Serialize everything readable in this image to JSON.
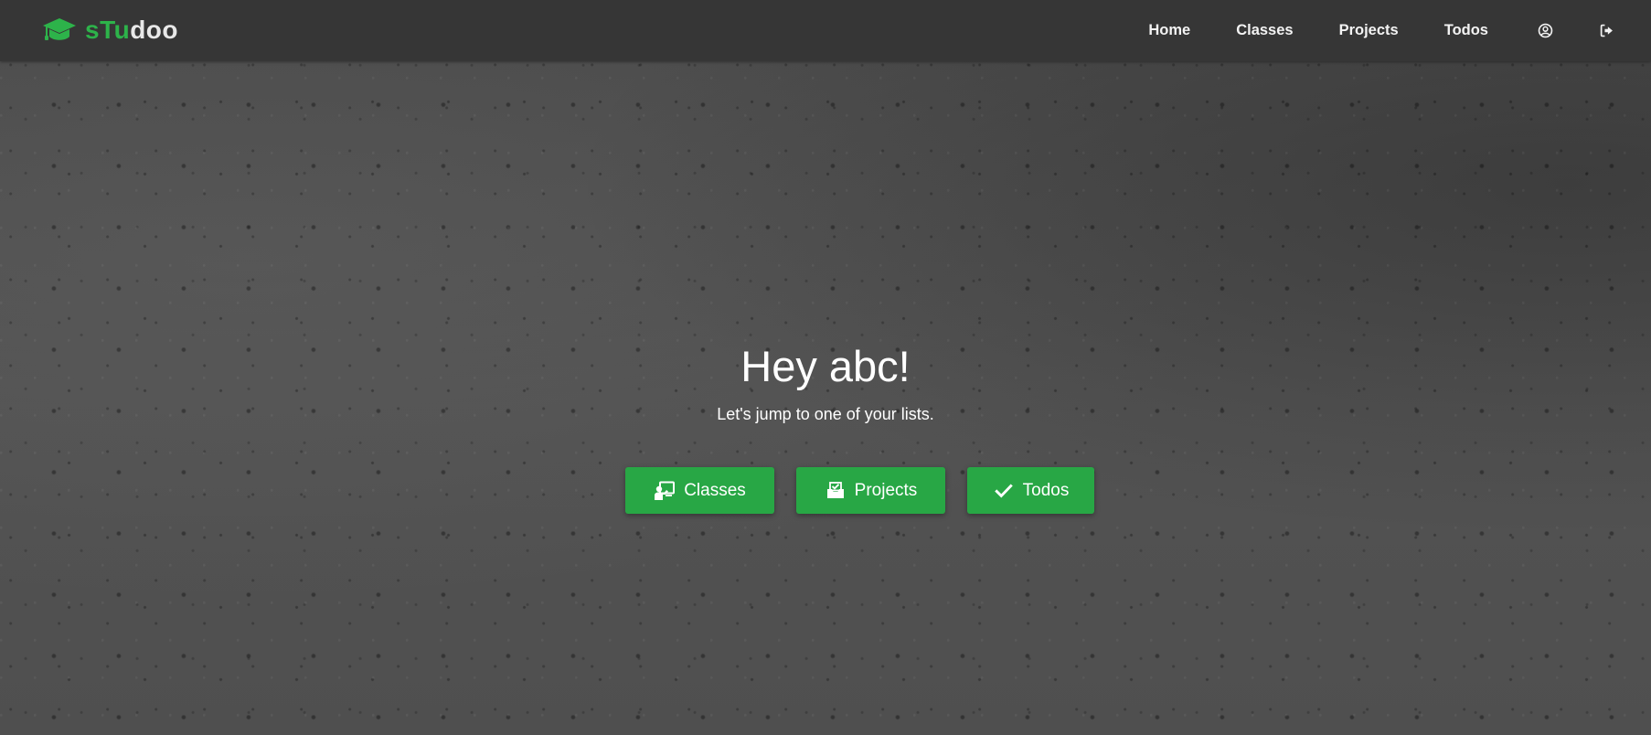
{
  "brand": {
    "part1": "sTu",
    "part2": "doo",
    "icon": "graduation-cap-icon",
    "accent_color": "#2db34a"
  },
  "nav": {
    "items": [
      {
        "label": "Home"
      },
      {
        "label": "Classes"
      },
      {
        "label": "Projects"
      },
      {
        "label": "Todos"
      }
    ],
    "icons": [
      "user-circle-icon",
      "sign-out-icon"
    ]
  },
  "hero": {
    "title": "Hey abc!",
    "subtitle": "Let's jump to one of your lists."
  },
  "buttons": [
    {
      "label": "Classes",
      "icon": "chalkboard-teacher-icon"
    },
    {
      "label": "Projects",
      "icon": "inbox-check-icon"
    },
    {
      "label": "Todos",
      "icon": "check-icon"
    }
  ],
  "colors": {
    "navbar_bg": "#363636",
    "button_bg": "#28a745",
    "text": "#ffffff"
  }
}
